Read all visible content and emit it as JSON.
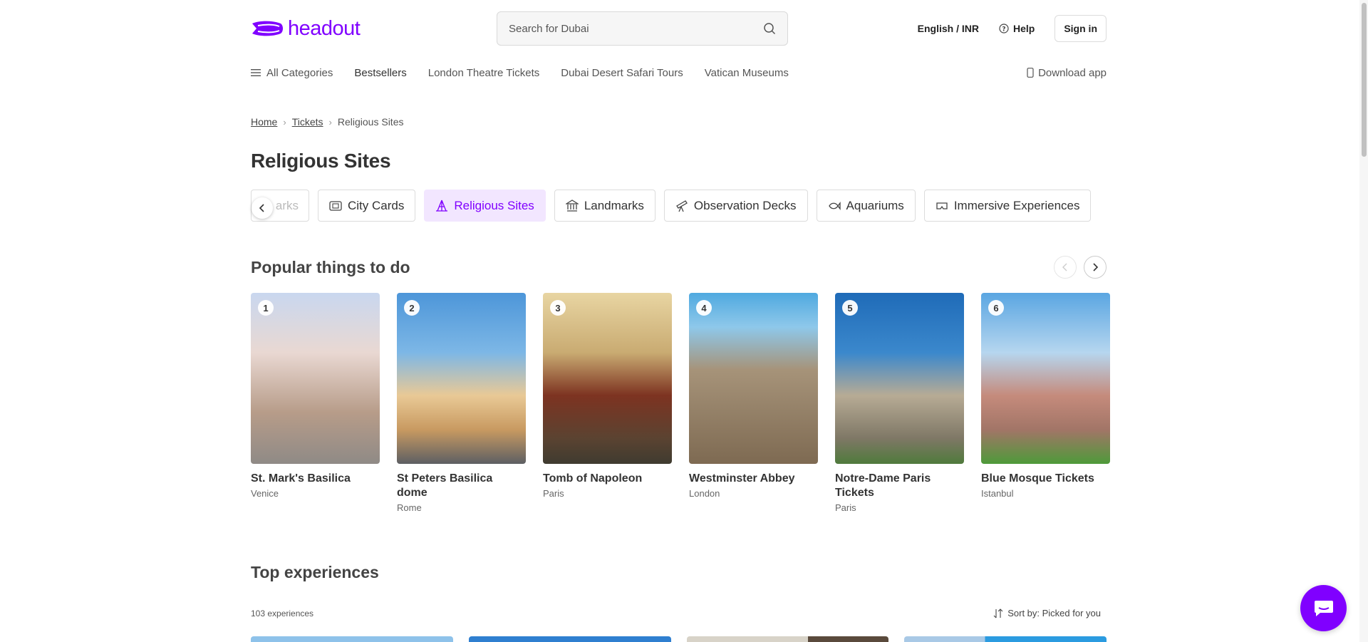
{
  "header": {
    "logo_text": "headout",
    "brand_color": "#8000ff",
    "search_placeholder": "Search for Dubai",
    "language": "English / INR",
    "help": "Help",
    "signin": "Sign in"
  },
  "nav": {
    "all_categories": "All Categories",
    "items": [
      "Bestsellers",
      "London Theatre Tickets",
      "Dubai Desert Safari Tours",
      "Vatican Museums"
    ],
    "download_app": "Download app"
  },
  "breadcrumb": {
    "home": "Home",
    "tickets": "Tickets",
    "current": "Religious Sites"
  },
  "page_title": "Religious Sites",
  "categories": {
    "partial": "arks",
    "items": [
      "City Cards",
      "Religious Sites",
      "Landmarks",
      "Observation Decks",
      "Aquariums",
      "Immersive Experiences"
    ],
    "active": "Religious Sites"
  },
  "popular": {
    "title": "Popular things to do",
    "cards": [
      {
        "rank": "1",
        "name": "St. Mark's Basilica",
        "city": "Venice"
      },
      {
        "rank": "2",
        "name": "St Peters Basilica dome",
        "city": "Rome"
      },
      {
        "rank": "3",
        "name": "Tomb of Napoleon",
        "city": "Paris"
      },
      {
        "rank": "4",
        "name": "Westminster Abbey",
        "city": "London"
      },
      {
        "rank": "5",
        "name": "Notre-Dame Paris Tickets",
        "city": "Paris"
      },
      {
        "rank": "6",
        "name": "Blue Mosque Tickets",
        "city": "Istanbul"
      }
    ]
  },
  "top_experiences": {
    "title": "Top experiences",
    "count": "103 experiences",
    "sort": "Sort by: Picked for you"
  }
}
